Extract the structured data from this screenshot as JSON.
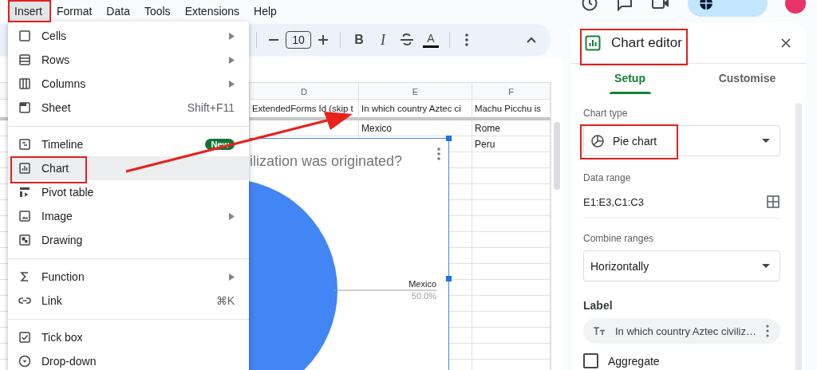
{
  "menu_bar": [
    {
      "label": "Insert",
      "selected": true
    },
    {
      "label": "Format",
      "selected": false
    },
    {
      "label": "Data",
      "selected": false
    },
    {
      "label": "Tools",
      "selected": false
    },
    {
      "label": "Extensions",
      "selected": false
    },
    {
      "label": "Help",
      "selected": false
    }
  ],
  "toolbar": {
    "font_size": "10",
    "bold": "B",
    "italic": "I",
    "text_color": "A"
  },
  "sheet": {
    "columns": [
      "D",
      "E",
      "F"
    ],
    "rows": [
      {
        "D": "ExtendedForms Id (skip t",
        "E": "In which country Aztec ci",
        "F": "Machu Picchu is"
      },
      {
        "E": "Mexico",
        "F": "Rome"
      },
      {
        "F": "Peru"
      }
    ]
  },
  "chart": {
    "chart_data": {
      "type": "pie",
      "title": "ilization was originated?",
      "categories": [
        "Mexico"
      ],
      "values": [
        50.0
      ],
      "value_labels": [
        "50.0%"
      ]
    }
  },
  "insert_menu": {
    "items": [
      {
        "kind": "item",
        "label": "Cells",
        "submenu": true,
        "selected": false
      },
      {
        "kind": "item",
        "label": "Rows",
        "submenu": true,
        "selected": false
      },
      {
        "kind": "item",
        "label": "Columns",
        "submenu": true,
        "selected": false
      },
      {
        "kind": "item",
        "label": "Sheet",
        "shortcut": "Shift+F11",
        "selected": false
      },
      {
        "kind": "divider"
      },
      {
        "kind": "item",
        "label": "Timeline",
        "badge": "New",
        "selected": false
      },
      {
        "kind": "item",
        "label": "Chart",
        "selected": true
      },
      {
        "kind": "item",
        "label": "Pivot table",
        "selected": false
      },
      {
        "kind": "item",
        "label": "Image",
        "submenu": true,
        "selected": false
      },
      {
        "kind": "item",
        "label": "Drawing",
        "selected": false
      },
      {
        "kind": "divider"
      },
      {
        "kind": "item",
        "label": "Function",
        "submenu": true,
        "selected": false
      },
      {
        "kind": "item",
        "label": "Link",
        "shortcut": "⌘K",
        "selected": false
      },
      {
        "kind": "divider"
      },
      {
        "kind": "item",
        "label": "Tick box",
        "selected": false
      },
      {
        "kind": "item",
        "label": "Drop-down",
        "selected": false
      }
    ]
  },
  "chart_editor": {
    "title": "Chart editor",
    "tabs": [
      {
        "label": "Setup",
        "selected": true
      },
      {
        "label": "Customise",
        "selected": false
      }
    ],
    "chart_type": {
      "label": "Chart type",
      "value": "Pie chart"
    },
    "data_range": {
      "label": "Data range",
      "value": "E1:E3,C1:C3"
    },
    "combine_ranges": {
      "label": "Combine ranges",
      "value": "Horizontally"
    },
    "label_section": {
      "heading": "Label",
      "chip": "In which country Aztec civiliz…"
    },
    "aggregate": {
      "label": "Aggregate",
      "checked": false
    }
  }
}
